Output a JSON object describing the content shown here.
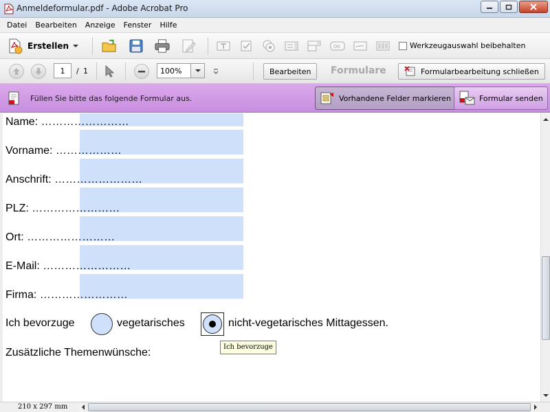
{
  "window": {
    "title": "Anmeldeformular.pdf - Adobe Acrobat Pro"
  },
  "menu": [
    "Datei",
    "Bearbeiten",
    "Anzeige",
    "Fenster",
    "Hilfe"
  ],
  "toolbar": {
    "create_label": "Erstellen",
    "keep_tool_label": "Werkzeugauswahl beibehalten",
    "keep_tool_checked": false
  },
  "nav": {
    "page_current": "1",
    "page_separator": "/",
    "page_total": "1",
    "zoom": "100%",
    "edit_label": "Bearbeiten",
    "formulare_label": "Formulare",
    "close_form_edit_label": "Formularbearbeitung schließen"
  },
  "formbar": {
    "message": "Füllen Sie bitte das folgende Formular aus.",
    "highlight_fields_label": "Vorhandene Felder markieren",
    "submit_label": "Formular senden"
  },
  "form": {
    "fields": [
      {
        "label": "Name: ……………………"
      },
      {
        "label": "Vorname: ………………"
      },
      {
        "label": "Anschrift: ……………………"
      },
      {
        "label": "PLZ: ……………………"
      },
      {
        "label": "Ort: ……………………"
      },
      {
        "label": "E-Mail: ……………………"
      },
      {
        "label": "Firma: ……………………"
      }
    ],
    "preference_prefix": "Ich bevorzuge",
    "option_1": "vegetarisches",
    "option_2": "nicht-vegetarisches Mittagessen.",
    "selected_option": 2,
    "tooltip": "Ich bevorzuge",
    "topics_label": "Zusätzliche Themenwünsche:"
  },
  "status": {
    "page_size": "210 x 297 mm"
  }
}
